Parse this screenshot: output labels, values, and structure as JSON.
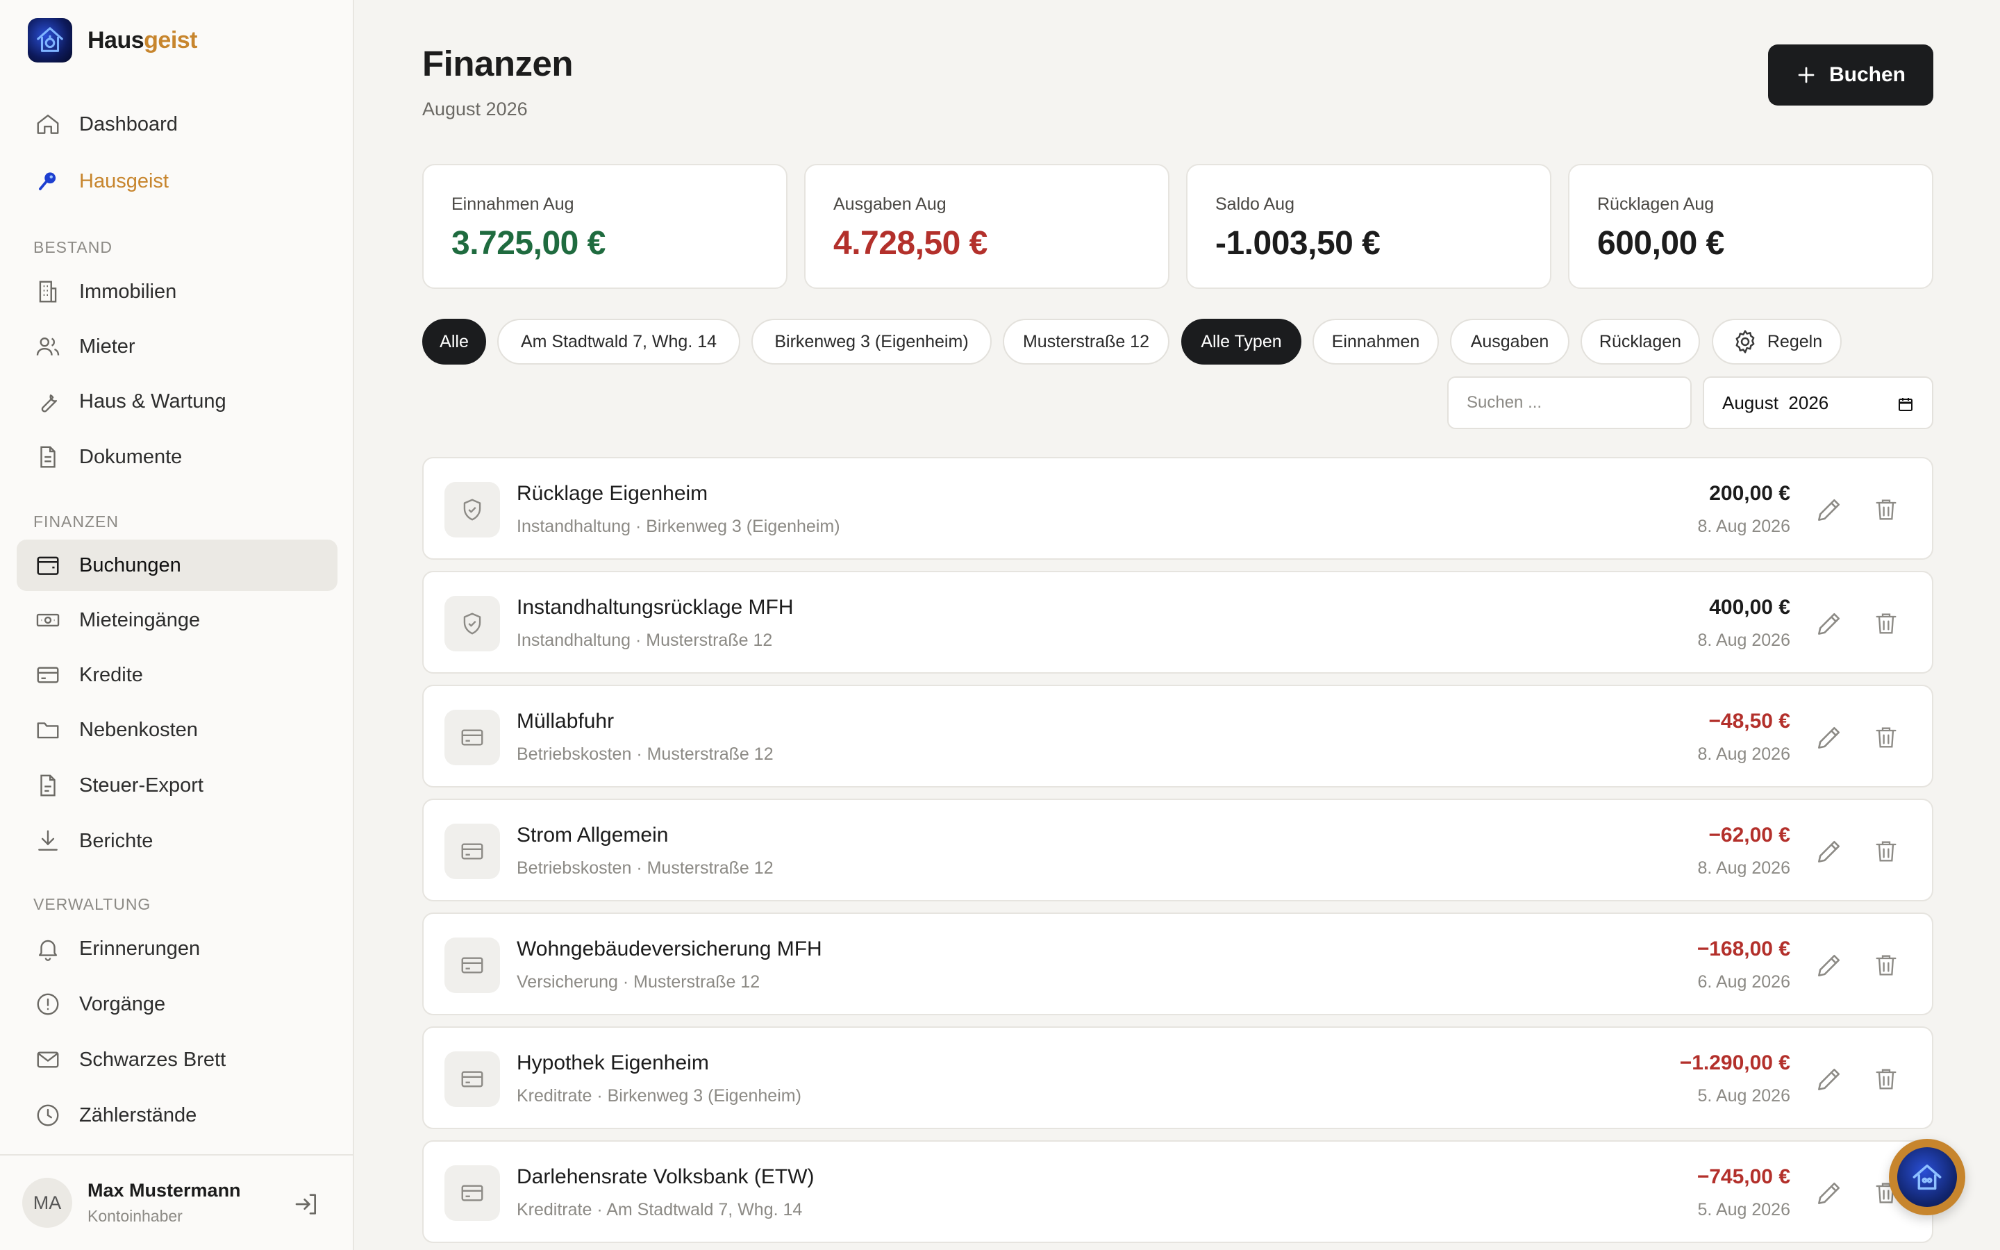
{
  "brand": {
    "name_main": "Haus",
    "name_accent": "geist",
    "accent_color": "#c7852d"
  },
  "sidebar": {
    "top_items": [
      {
        "label": "Dashboard",
        "icon": "home-icon"
      },
      {
        "label": "Hausgeist",
        "icon": "ghost-icon"
      }
    ],
    "sections": [
      {
        "label": "BESTAND",
        "items": [
          {
            "label": "Immobilien",
            "icon": "building-icon"
          },
          {
            "label": "Mieter",
            "icon": "users-icon"
          },
          {
            "label": "Haus & Wartung",
            "icon": "wrench-icon"
          },
          {
            "label": "Dokumente",
            "icon": "document-icon"
          }
        ]
      },
      {
        "label": "FINANZEN",
        "items": [
          {
            "label": "Buchungen",
            "icon": "wallet-icon",
            "active": true
          },
          {
            "label": "Mieteingänge",
            "icon": "banknote-icon"
          },
          {
            "label": "Kredite",
            "icon": "credit-card-icon"
          },
          {
            "label": "Nebenkosten",
            "icon": "folder-icon"
          },
          {
            "label": "Steuer-Export",
            "icon": "file-icon"
          },
          {
            "label": "Berichte",
            "icon": "download-icon"
          }
        ]
      },
      {
        "label": "VERWALTUNG",
        "items": [
          {
            "label": "Erinnerungen",
            "icon": "bell-icon"
          },
          {
            "label": "Vorgänge",
            "icon": "alert-circle-icon"
          },
          {
            "label": "Schwarzes Brett",
            "icon": "mail-icon"
          },
          {
            "label": "Zählerstände",
            "icon": "clock-icon"
          }
        ]
      }
    ],
    "user": {
      "initials": "MA",
      "name": "Max Mustermann",
      "role": "Kontoinhaber"
    }
  },
  "header": {
    "title": "Finanzen",
    "subtitle": "August 2026",
    "book_button": "Buchen"
  },
  "stats": [
    {
      "label": "Einnahmen Aug",
      "value": "3.725,00 €",
      "color": "#1f6b3f"
    },
    {
      "label": "Ausgaben Aug",
      "value": "4.728,50 €",
      "color": "#b3302b"
    },
    {
      "label": "Saldo Aug",
      "value": "-1.003,50 €",
      "color": "#1c1c1c"
    },
    {
      "label": "Rücklagen Aug",
      "value": "600,00 €",
      "color": "#1c1c1c"
    }
  ],
  "filters": {
    "properties": [
      "Alle",
      "Am Stadtwald 7, Whg. 14",
      "Birkenweg 3 (Eigenheim)",
      "Musterstraße 12"
    ],
    "types": [
      "Alle Typen",
      "Einnahmen",
      "Ausgaben",
      "Rücklagen"
    ],
    "rules_label": "Regeln",
    "search_placeholder": "Suchen ...",
    "month_value": "August  2026"
  },
  "transactions": [
    {
      "title": "Rücklage Eigenheim",
      "meta": "Instandhaltung · Birkenweg 3 (Eigenheim)",
      "amount": "200,00 €",
      "date": "8. Aug 2026",
      "kind": "reserve",
      "icon": "shield-check-icon"
    },
    {
      "title": "Instandhaltungsrücklage MFH",
      "meta": "Instandhaltung · Musterstraße 12",
      "amount": "400,00 €",
      "date": "8. Aug 2026",
      "kind": "reserve",
      "icon": "shield-check-icon"
    },
    {
      "title": "Müllabfuhr",
      "meta": "Betriebskosten · Musterstraße 12",
      "amount": "−48,50 €",
      "date": "8. Aug 2026",
      "kind": "expense",
      "icon": "credit-card-icon"
    },
    {
      "title": "Strom Allgemein",
      "meta": "Betriebskosten · Musterstraße 12",
      "amount": "−62,00 €",
      "date": "8. Aug 2026",
      "kind": "expense",
      "icon": "credit-card-icon"
    },
    {
      "title": "Wohngebäudeversicherung MFH",
      "meta": "Versicherung · Musterstraße 12",
      "amount": "−168,00 €",
      "date": "6. Aug 2026",
      "kind": "expense",
      "icon": "credit-card-icon"
    },
    {
      "title": "Hypothek Eigenheim",
      "meta": "Kreditrate · Birkenweg 3 (Eigenheim)",
      "amount": "−1.290,00 €",
      "date": "5. Aug 2026",
      "kind": "expense",
      "icon": "credit-card-icon"
    },
    {
      "title": "Darlehensrate Volksbank (ETW)",
      "meta": "Kreditrate · Am Stadtwald 7, Whg. 14",
      "amount": "−745,00 €",
      "date": "5. Aug 2026",
      "kind": "expense",
      "icon": "credit-card-icon"
    }
  ]
}
